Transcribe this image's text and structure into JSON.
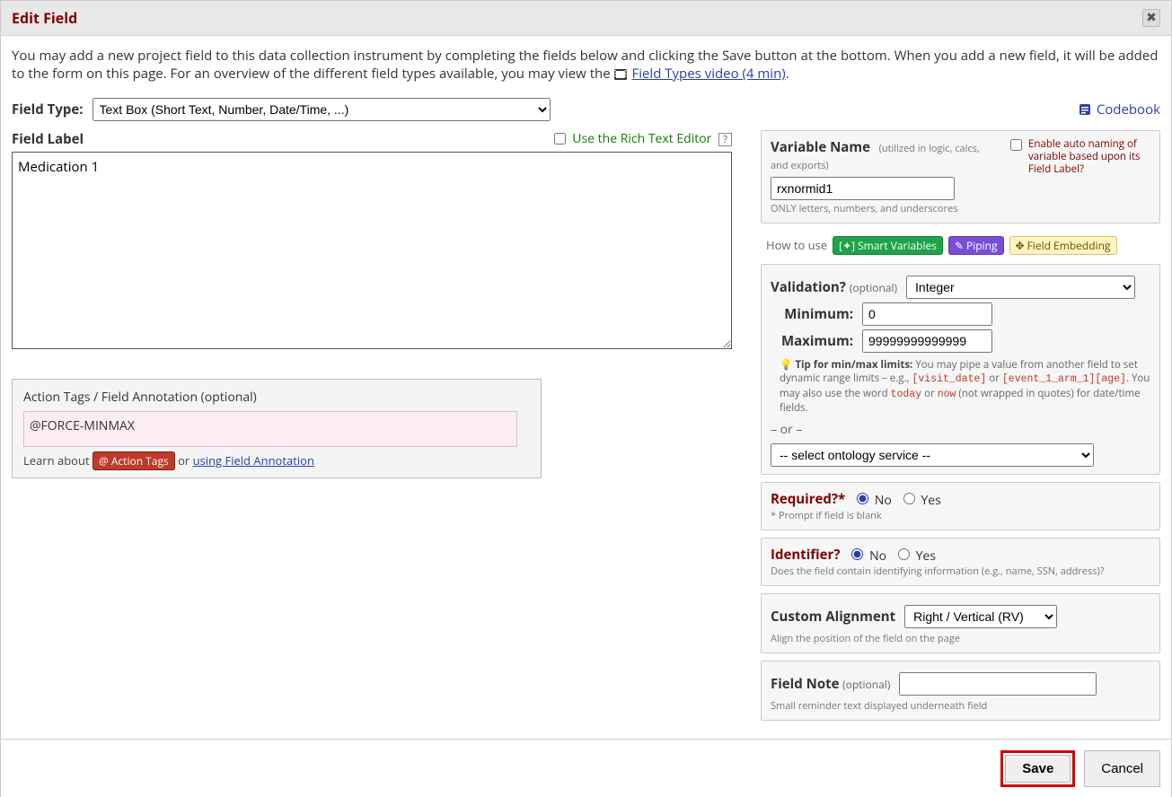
{
  "header": {
    "title": "Edit Field"
  },
  "intro": {
    "part1": "You may add a new project field to this data collection instrument by completing the fields below and clicking the Save button at the bottom. When you add a new field, it will be added to the form on this page. For an overview of the different field types available, you may view the ",
    "link": "Field Types video (4 min)",
    "part2": "."
  },
  "fieldtype": {
    "label": "Field Type:",
    "selected": "Text Box (Short Text, Number, Date/Time, ...)"
  },
  "codebook": {
    "label": "Codebook"
  },
  "fieldlabel": {
    "label": "Field Label",
    "richtext": "Use the Rich Text Editor",
    "value": "Medication 1"
  },
  "actiontags": {
    "title": "Action Tags",
    "sep": "/",
    "annotation": "Field Annotation",
    "optional": "(optional)",
    "value": "@FORCE-MINMAX",
    "learn": "Learn about",
    "badge": "@ Action Tags",
    "or": "or",
    "link": "using Field Annotation"
  },
  "varname": {
    "label": "Variable Name",
    "hint": "(utilized in logic, calcs, and exports)",
    "value": "rxnormid1",
    "rule": "ONLY letters, numbers, and underscores",
    "autoname": "Enable auto naming of variable based upon its Field Label?"
  },
  "howto": {
    "text": "How to use",
    "smart": "Smart Variables",
    "piping": "Piping",
    "embed": "Field Embedding"
  },
  "validation": {
    "label": "Validation?",
    "optional": "(optional)",
    "selected": "Integer",
    "min_label": "Minimum:",
    "min_value": "0",
    "max_label": "Maximum:",
    "max_value": "99999999999999",
    "tip_label": "Tip for min/max limits:",
    "tip_1": " You may pipe a value from another field to set dynamic range limits – e.g., ",
    "kw1": "[visit_date]",
    "or": " or ",
    "kw2": "[event_1_arm_1][age]",
    "tip_2": ". You may also use the word ",
    "kw3": "today",
    "kw4": "now",
    "tip_3": " (not wrapped in quotes) for date/time fields.",
    "or_sep": "– or –",
    "ontology": "-- select ontology service --"
  },
  "required": {
    "label": "Required?*",
    "no": "No",
    "yes": "Yes",
    "prompt": "* Prompt if field is blank"
  },
  "identifier": {
    "label": "Identifier?",
    "no": "No",
    "yes": "Yes",
    "desc": "Does the field contain identifying information (e.g., name, SSN, address)?"
  },
  "alignment": {
    "label": "Custom Alignment",
    "selected": "Right / Vertical (RV)",
    "desc": "Align the position of the field on the page"
  },
  "fieldnote": {
    "label": "Field Note",
    "optional": "(optional)",
    "desc": "Small reminder text displayed underneath field",
    "value": ""
  },
  "footer": {
    "save": "Save",
    "cancel": "Cancel"
  }
}
